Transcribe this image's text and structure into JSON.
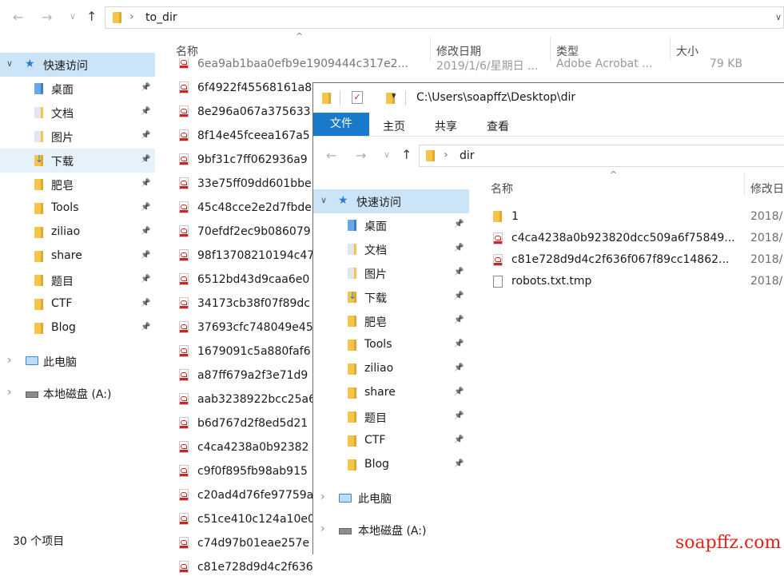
{
  "back": {
    "address": {
      "path": "to_dir"
    },
    "sort_arrow": "^",
    "columns": {
      "name": "名称",
      "date": "修改日期",
      "type": "类型",
      "size": "大小"
    },
    "first_row": {
      "name": "6ea9ab1baa0efb9e1909444c317e2...",
      "date": "2019/1/6/星期日 ...",
      "type": "Adobe Acrobat ...",
      "size": "79 KB"
    },
    "nav": [
      {
        "label": "快速访问",
        "icon": "star-icon",
        "selected": true
      },
      {
        "label": "桌面",
        "icon": "folder-blue-icon"
      },
      {
        "label": "文档",
        "icon": "folder-doc-icon"
      },
      {
        "label": "图片",
        "icon": "folder-doc-icon"
      },
      {
        "label": "下载",
        "icon": "download-icon",
        "selected": true
      },
      {
        "label": "肥皂",
        "icon": "folder-icon"
      },
      {
        "label": "Tools",
        "icon": "folder-icon"
      },
      {
        "label": "ziliao",
        "icon": "folder-icon"
      },
      {
        "label": "share",
        "icon": "folder-icon"
      },
      {
        "label": "题目",
        "icon": "folder-icon"
      },
      {
        "label": "CTF",
        "icon": "folder-icon"
      },
      {
        "label": "Blog",
        "icon": "folder-icon"
      }
    ],
    "this_pc": "此电脑",
    "local_disk": "本地磁盘 (A:)",
    "files": [
      "6f4922f45568161a8",
      "8e296a067a375633",
      "8f14e45fceea167a5",
      "9bf31c7ff062936a9",
      "33e75ff09dd601bbe",
      "45c48cce2e2d7fbde",
      "70efdf2ec9b086079",
      "98f13708210194c47",
      "6512bd43d9caa6e0",
      "34173cb38f07f89dc",
      "37693cfc748049e45",
      "1679091c5a880faf6",
      "a87ff679a2f3e71d9",
      "aab3238922bcc25a6",
      "b6d767d2f8ed5d21",
      "c4ca4238a0b92382",
      "c9f0f895fb98ab915",
      "c20ad4d76fe97759a",
      "c51ce410c124a10e0",
      "c74d97b01eae257e",
      "c81e728d9d4c2f636"
    ],
    "status": "30 个项目"
  },
  "front": {
    "title": "C:\\Users\\soapffz\\Desktop\\dir",
    "ribbon": {
      "file": "文件",
      "home": "主页",
      "share": "共享",
      "view": "查看"
    },
    "address": {
      "path": "dir"
    },
    "sort_arrow": "^",
    "columns": {
      "name": "名称",
      "date": "修改日"
    },
    "nav": [
      {
        "label": "快速访问",
        "icon": "star-icon",
        "selected": true
      },
      {
        "label": "桌面",
        "icon": "folder-blue-icon"
      },
      {
        "label": "文档",
        "icon": "folder-doc-icon"
      },
      {
        "label": "图片",
        "icon": "folder-doc-icon"
      },
      {
        "label": "下载",
        "icon": "download-icon"
      },
      {
        "label": "肥皂",
        "icon": "folder-icon"
      },
      {
        "label": "Tools",
        "icon": "folder-icon"
      },
      {
        "label": "ziliao",
        "icon": "folder-icon"
      },
      {
        "label": "share",
        "icon": "folder-icon"
      },
      {
        "label": "题目",
        "icon": "folder-icon"
      },
      {
        "label": "CTF",
        "icon": "folder-icon"
      },
      {
        "label": "Blog",
        "icon": "folder-icon"
      }
    ],
    "this_pc": "此电脑",
    "local_disk": "本地磁盘 (A:)",
    "files": [
      {
        "name": "1",
        "icon": "folder-icon",
        "date": "2018/"
      },
      {
        "name": "c4ca4238a0b923820dcc509a6f75849...",
        "icon": "pdf-icon",
        "date": "2018/"
      },
      {
        "name": "c81e728d9d4c2f636f067f89cc14862...",
        "icon": "pdf-icon",
        "date": "2018/"
      },
      {
        "name": "robots.txt.tmp",
        "icon": "file-icon",
        "date": "2018/"
      }
    ]
  },
  "watermark": "soapffz.com",
  "colors": {
    "ribbon_file": "#1979ca",
    "selection": "#cce4f7",
    "watermark": "#e0261b"
  }
}
